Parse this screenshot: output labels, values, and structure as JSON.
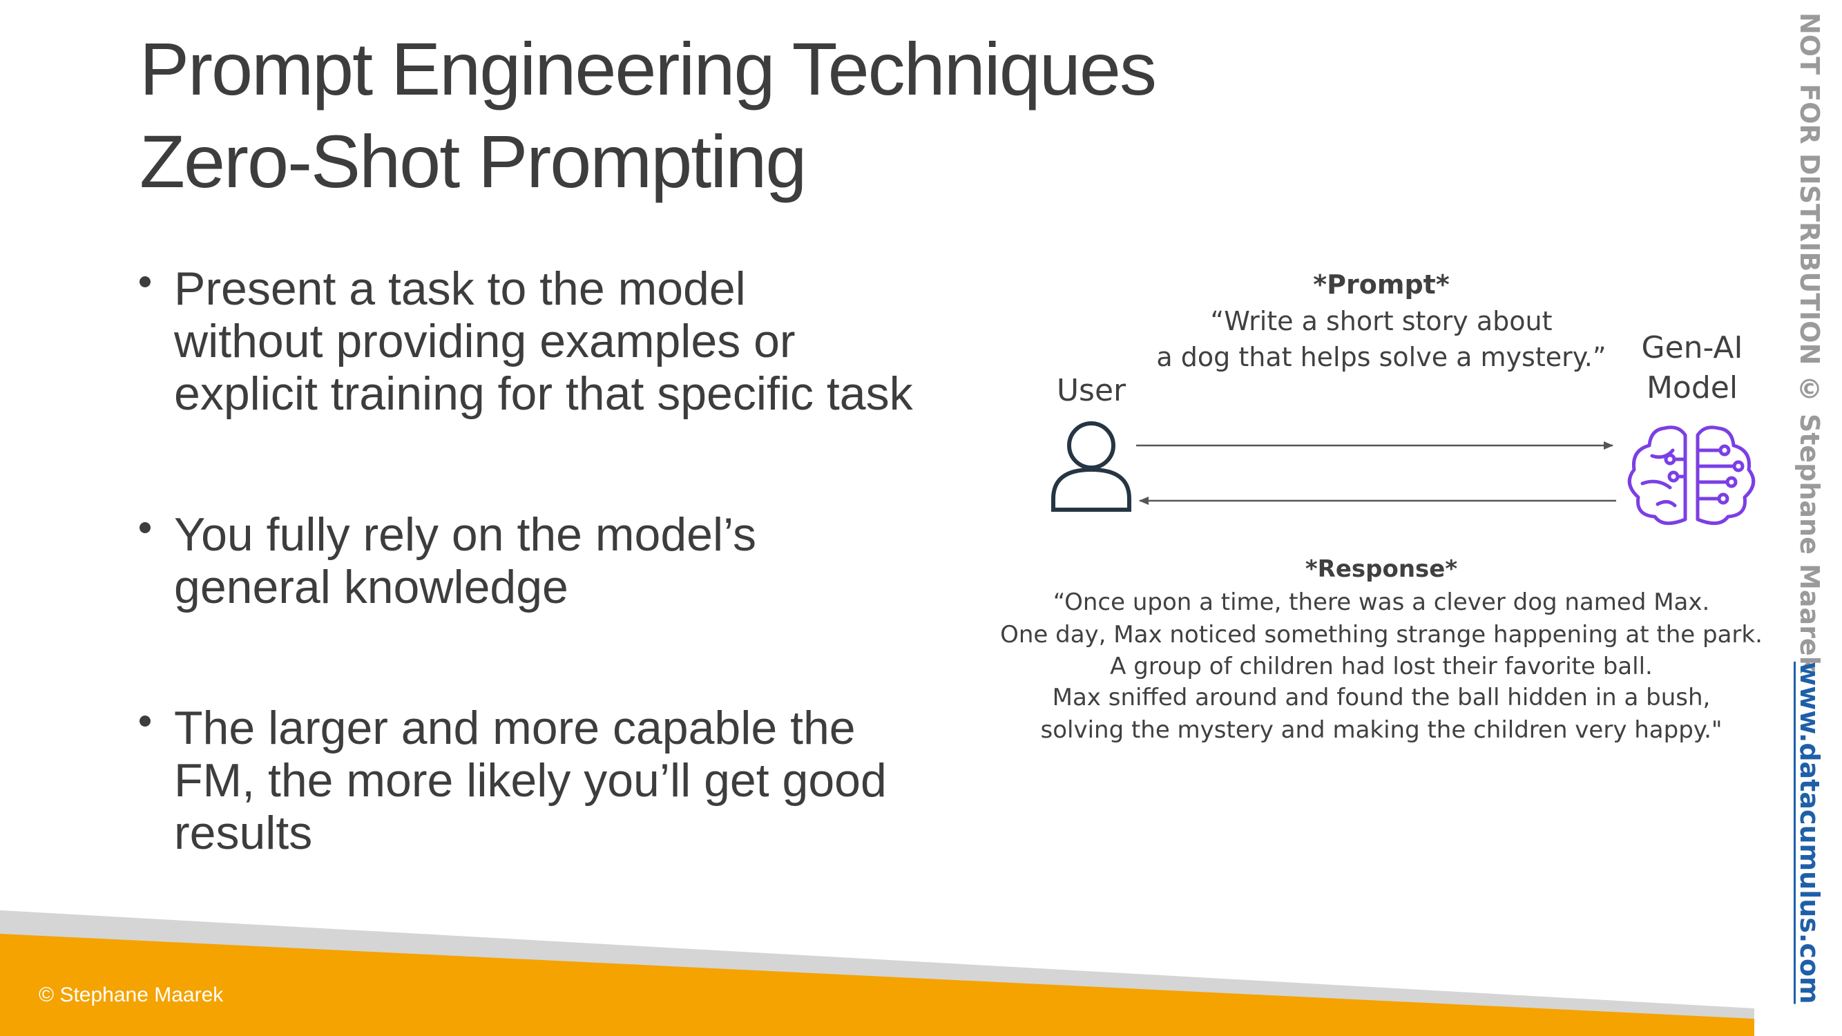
{
  "slide": {
    "title": "Prompt Engineering Techniques",
    "subtitle": "Zero-Shot Prompting",
    "bullets": [
      {
        "lines": [
          "Present a task to the model",
          "without providing examples or",
          "explicit training for that specific task"
        ]
      },
      {
        "lines": [
          "You fully rely on the model’s",
          "general knowledge"
        ]
      },
      {
        "lines": [
          "The larger and more capable the",
          "FM, the more likely you’ll get good",
          "results"
        ]
      }
    ]
  },
  "diagram": {
    "prompt_heading": "*Prompt*",
    "prompt_lines": [
      "“Write a short story about",
      "a dog that helps solve a mystery.”"
    ],
    "user_label": "User",
    "model_label_lines": [
      "Gen-AI",
      "Model"
    ],
    "response_heading": "*Response*",
    "response_lines": [
      "“Once upon a time, there was a clever dog named Max.",
      "One day, Max noticed something strange happening at the park.",
      "A group of children had lost their favorite ball.",
      "Max sniffed around and found the ball hidden in a bush,",
      "solving the mystery and making the children very happy.\""
    ],
    "icons": {
      "user": "user-icon",
      "model": "brain-circuit-icon"
    },
    "colors": {
      "brain": "#7b3fe4",
      "arrow": "#555555"
    }
  },
  "watermark": {
    "not_for_distribution": "NOT FOR DISTRIBUTION © Stephane Maarek",
    "website": "www.datacumulus.com"
  },
  "footer": {
    "copyright": "© Stephane Maarek",
    "accent_color": "#f4a300",
    "stripe_color": "#d5d5d5"
  }
}
